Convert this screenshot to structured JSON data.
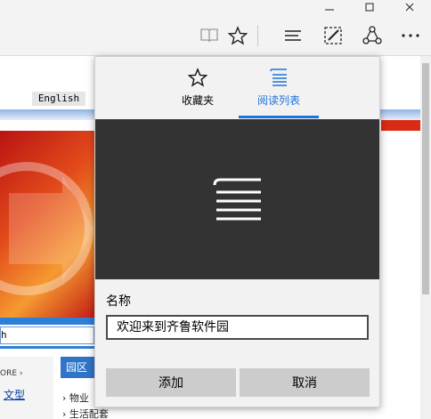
{
  "page": {
    "language_link": "English",
    "search_text": "h",
    "more_label": "ORE ›",
    "left_link": "文型",
    "right_column_title": "园区",
    "right_items": [
      "› 物业",
      "› 生活配套"
    ]
  },
  "panel": {
    "tabs": [
      {
        "label": "收藏夹",
        "icon": "star-icon",
        "active": false
      },
      {
        "label": "阅读列表",
        "icon": "reading-list-icon",
        "active": true
      }
    ],
    "name_label": "名称",
    "name_value": "欢迎来到齐鲁软件园",
    "add_button": "添加",
    "cancel_button": "取消"
  },
  "colors": {
    "accent": "#1e73d8",
    "preview_bg": "#333333",
    "button_bg": "#cccccc"
  }
}
